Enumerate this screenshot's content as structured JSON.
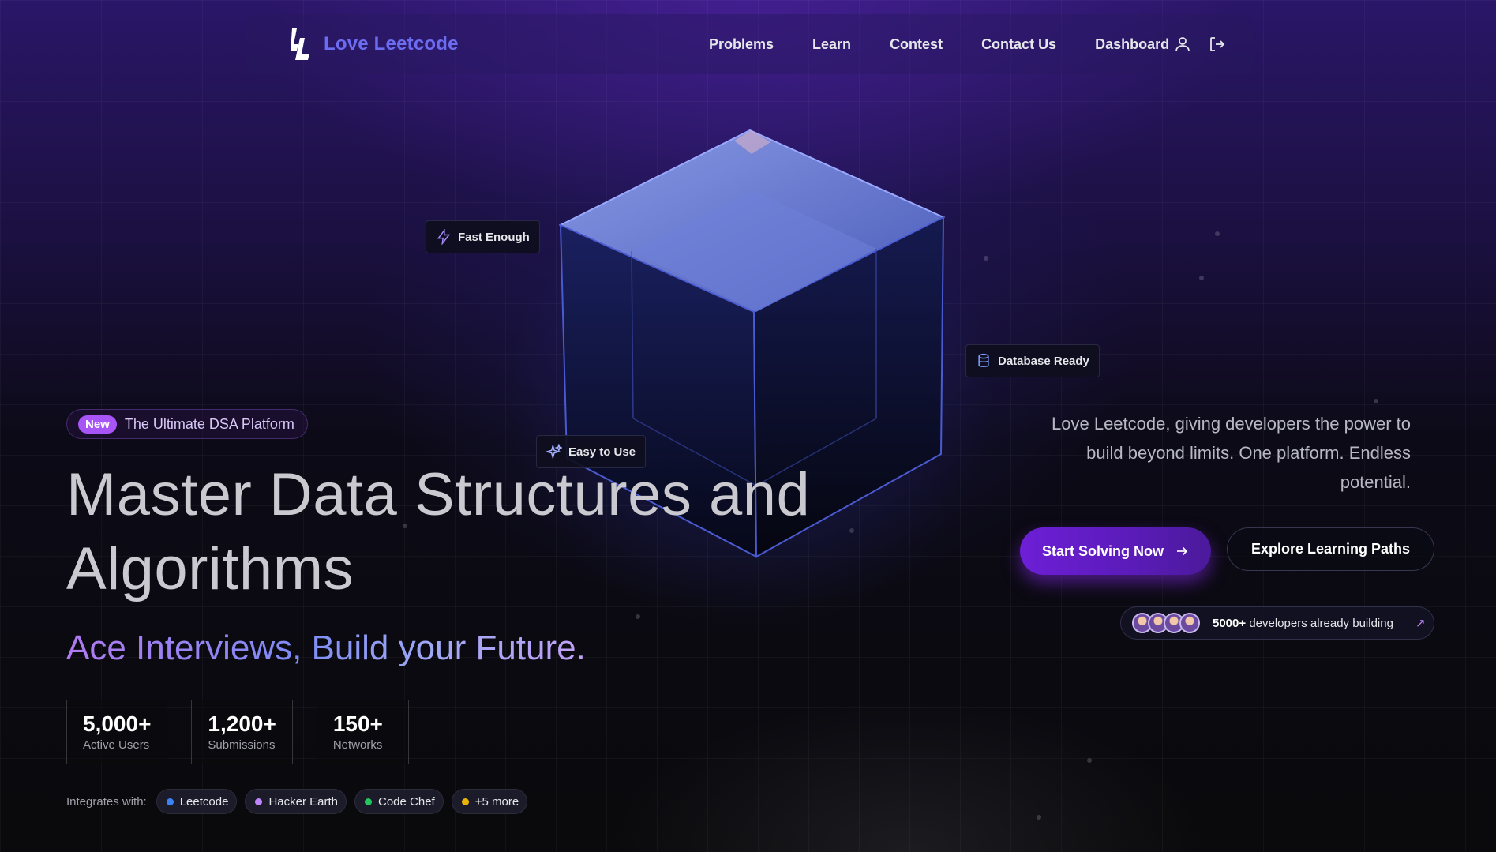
{
  "brand": {
    "name": "Love Leetcode",
    "color": "#6b6cf0"
  },
  "nav": {
    "links": [
      "Problems",
      "Learn",
      "Contest",
      "Contact Us",
      "Dashboard"
    ],
    "icons": [
      "user-icon",
      "logout-icon"
    ]
  },
  "floating_tags": {
    "fast": "Fast Enough",
    "database": "Database Ready",
    "easy": "Easy to Use"
  },
  "hero": {
    "badge_new": "New",
    "badge_text": "The Ultimate DSA Platform",
    "title_line1": "Master Data Structures and",
    "title_line2": "Algorithms",
    "tagline": "Ace Interviews, Build your Future.",
    "description": "Love Leetcode, giving developers the power to build beyond limits. One platform. Endless potential.",
    "primary_button": "Start Solving Now",
    "secondary_button": "Explore Learning Paths",
    "developers_count": "5000+",
    "developers_text": "developers already building"
  },
  "stats": [
    {
      "value": "5,000+",
      "label": "Active Users"
    },
    {
      "value": "1,200+",
      "label": "Submissions"
    },
    {
      "value": "150+",
      "label": "Networks"
    }
  ],
  "integrations": {
    "label": "Integrates with:",
    "items": [
      {
        "name": "Leetcode",
        "color": "#3b82f6"
      },
      {
        "name": "Hacker Earth",
        "color": "#c084fc"
      },
      {
        "name": "Code Chef",
        "color": "#22c55e"
      },
      {
        "name": "+5 more",
        "color": "#eab308"
      }
    ]
  },
  "colors": {
    "accent_purple": "#a855f7",
    "primary_button": "#6d1fd6"
  }
}
